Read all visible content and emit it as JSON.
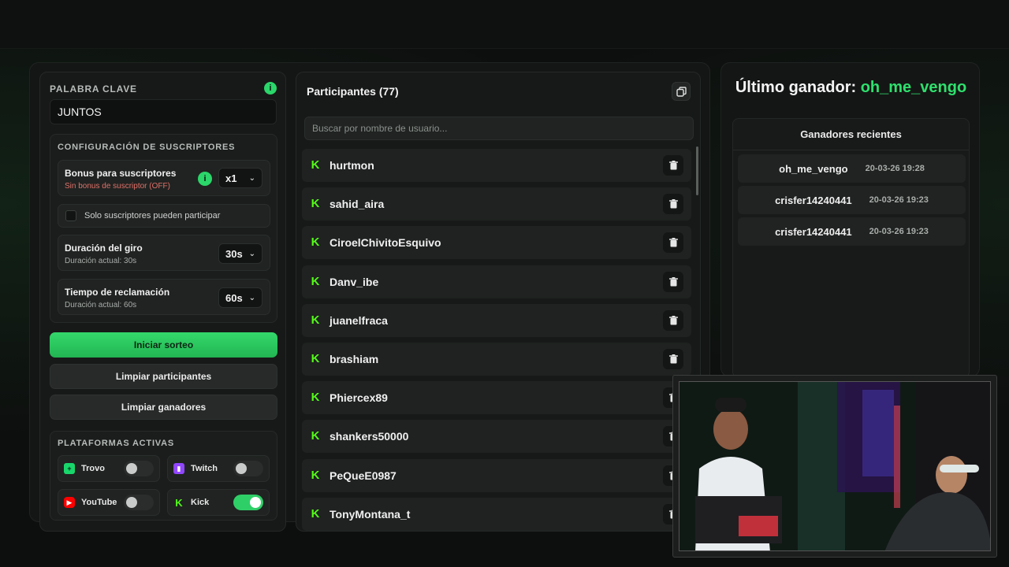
{
  "left_panel": {
    "keyword_label": "PALABRA CLAVE",
    "keyword_value": "JUNTOS",
    "subs_config_label": "CONFIGURACIÓN DE SUSCRIPTORES",
    "bonus": {
      "title": "Bonus para suscriptores",
      "subtitle": "Sin bonus de suscriptor (OFF)",
      "selected": "x1"
    },
    "subs_only_label": "Solo suscriptores pueden participar",
    "spin": {
      "title": "Duración del giro",
      "subtitle": "Duración actual: 30s",
      "selected": "30s"
    },
    "claim": {
      "title": "Tiempo de reclamación",
      "subtitle": "Duración actual: 60s",
      "selected": "60s"
    },
    "start_button": "Iniciar sorteo",
    "clear_participants_button": "Limpiar participantes",
    "clear_winners_button": "Limpiar ganadores",
    "platforms_label": "PLATAFORMAS ACTIVAS",
    "platforms": [
      {
        "name": "Trovo",
        "enabled": false,
        "color": "#19d66b"
      },
      {
        "name": "Twitch",
        "enabled": false,
        "color": "#9146ff"
      },
      {
        "name": "YouTube",
        "enabled": false,
        "color": "#ff0000"
      },
      {
        "name": "Kick",
        "enabled": true,
        "color": "#53fc18"
      }
    ]
  },
  "participants": {
    "title": "Participantes (77)",
    "search_placeholder": "Buscar por nombre de usuario...",
    "items": [
      "hurtmon",
      "sahid_aira",
      "CiroelChivitoEsquivo",
      "Danv_ibe",
      "juanelfraca",
      "brashiam",
      "Phiercex89",
      "shankers50000",
      "PeQueE0987",
      "TonyMontana_t"
    ]
  },
  "winners": {
    "title_prefix": "Último ganador: ",
    "last_winner": "oh_me_vengo",
    "recent_title": "Ganadores recientes",
    "recent": [
      {
        "name": "oh_me_vengo",
        "time": "20-03-26 19:28"
      },
      {
        "name": "crisfer14240441",
        "time": "20-03-26 19:23"
      },
      {
        "name": "crisfer14240441",
        "time": "20-03-26 19:23"
      }
    ]
  },
  "colors": {
    "accent": "#2ee06d",
    "kick": "#53fc18"
  }
}
